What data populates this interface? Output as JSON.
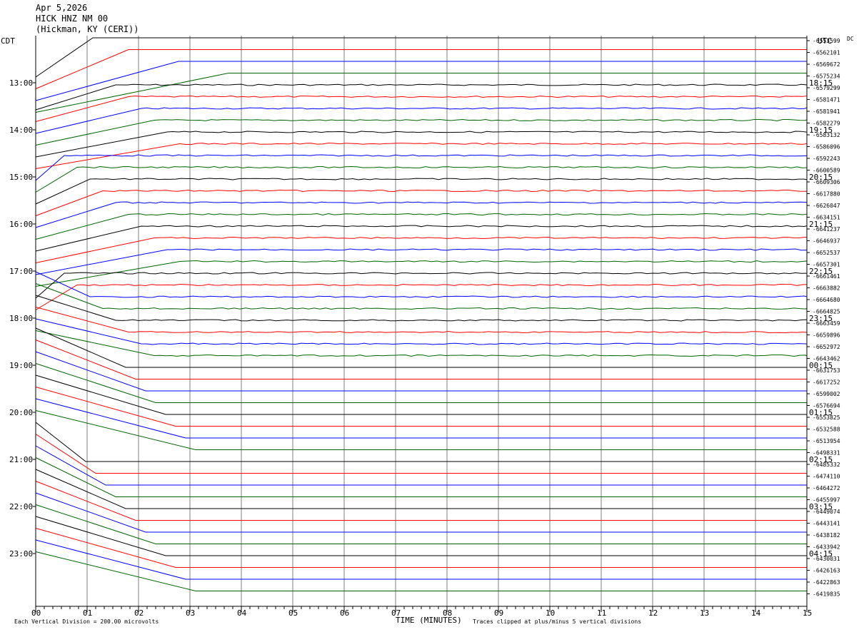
{
  "header": {
    "date": "Apr 5,2026",
    "station": "HICK HNZ NM 00",
    "location": "(Hickman, KY (CERI))"
  },
  "left_tz": "CDT",
  "right_tz": "UTC",
  "dc_label": "DC",
  "footer": {
    "scale_note": "Each Vertical Division =  200.00 microvolts",
    "clip_note": "Traces clipped at plus/minus 5 vertical divisions"
  },
  "colors": {
    "black": "#000000",
    "red": "#ff0000",
    "blue": "#0000ff",
    "green": "#006400",
    "grid": "#808080"
  },
  "chart_data": {
    "type": "line",
    "title": "HICK HNZ NM 00",
    "xlabel": "TIME (MINUTES)",
    "xlim": [
      0,
      15
    ],
    "x_ticks": [
      "00",
      "01",
      "02",
      "03",
      "04",
      "05",
      "06",
      "07",
      "08",
      "09",
      "10",
      "11",
      "12",
      "13",
      "14",
      "15"
    ],
    "left_hour_labels": [
      "13:00",
      "14:00",
      "15:00",
      "16:00",
      "17:00",
      "18:00",
      "19:00",
      "20:00",
      "21:00",
      "22:00",
      "23:00"
    ],
    "right_hour_labels": [
      "18:15",
      "19:15",
      "20:15",
      "21:15",
      "22:15",
      "23:15",
      "00:15",
      "01:15",
      "02:15",
      "03:15",
      "04:15"
    ],
    "color_cycle": [
      "black",
      "red",
      "blue",
      "green"
    ],
    "trace_offsets": [
      "-6553599",
      "-6562101",
      "-6569672",
      "-6575234",
      "-6579299",
      "-6581471",
      "-6581941",
      "-6582279",
      "-6583132",
      "-6586096",
      "-6592243",
      "-6600589",
      "-6609306",
      "-6617880",
      "-6626047",
      "-6634151",
      "-6641237",
      "-6646937",
      "-6652537",
      "-6657301",
      "-6661461",
      "-6663882",
      "-6664680",
      "-6664825",
      "-6663459",
      "-6659896",
      "-6652972",
      "-6643462",
      "-6631753",
      "-6617252",
      "-6599002",
      "-6576694",
      "-6553825",
      "-6532588",
      "-6513954",
      "-6498331",
      "-6485332",
      "-6474110",
      "-6464272",
      "-6455997",
      "-6449074",
      "-6443141",
      "-6438182",
      "-6433942",
      "-6430031",
      "-6426163",
      "-6422863",
      "-6419835"
    ]
  }
}
